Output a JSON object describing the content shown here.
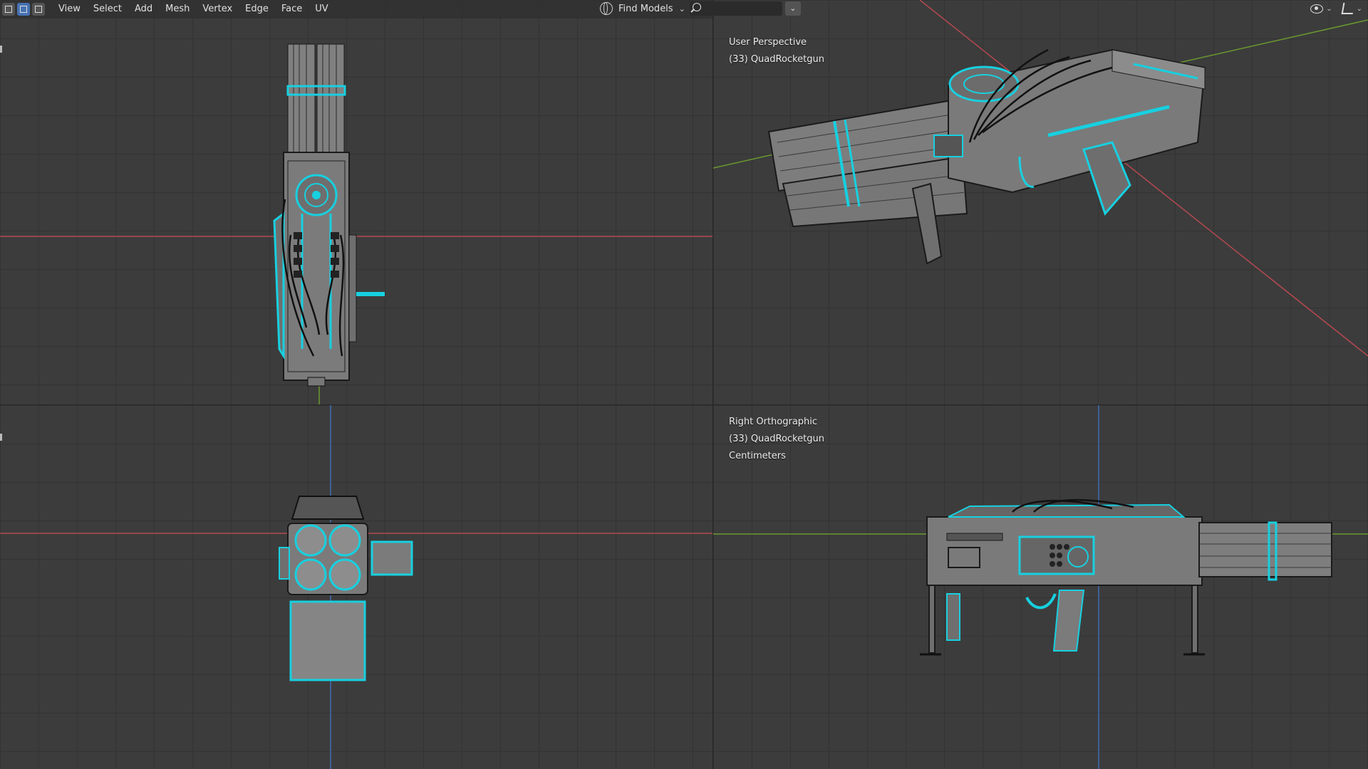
{
  "header": {
    "menus": [
      "View",
      "Select",
      "Add",
      "Mesh",
      "Vertex",
      "Edge",
      "Face",
      "UV"
    ],
    "find_models_label": "Find Models",
    "search_placeholder": ""
  },
  "viewports": {
    "top_left": {
      "view_name": "",
      "object": ""
    },
    "top_right": {
      "view_name": "User Perspective",
      "object": "(33) QuadRocketgun"
    },
    "bottom_left": {
      "view_name": "",
      "object": ""
    },
    "bottom_right": {
      "view_name": "Right Orthographic",
      "object": "(33) QuadRocketgun",
      "units": "Centimeters"
    }
  },
  "colors": {
    "background": "#3c3c3c",
    "grid_line": "#333333",
    "x_axis": "#b54950",
    "y_axis": "#6b9a2f",
    "z_axis": "#3f6fb5",
    "wire_highlight": "#17d0e0",
    "mesh_fill": "#7b7b7b",
    "header_bg": "#303030",
    "active_mode": "#4772b3"
  },
  "icons": {
    "mode_vertex": "vertex-select-icon",
    "mode_edge": "edge-select-icon",
    "mode_face": "face-select-icon",
    "globe": "globe-icon",
    "search": "search-icon",
    "visibility": "eye-icon",
    "gizmo": "gizmo-icon"
  }
}
